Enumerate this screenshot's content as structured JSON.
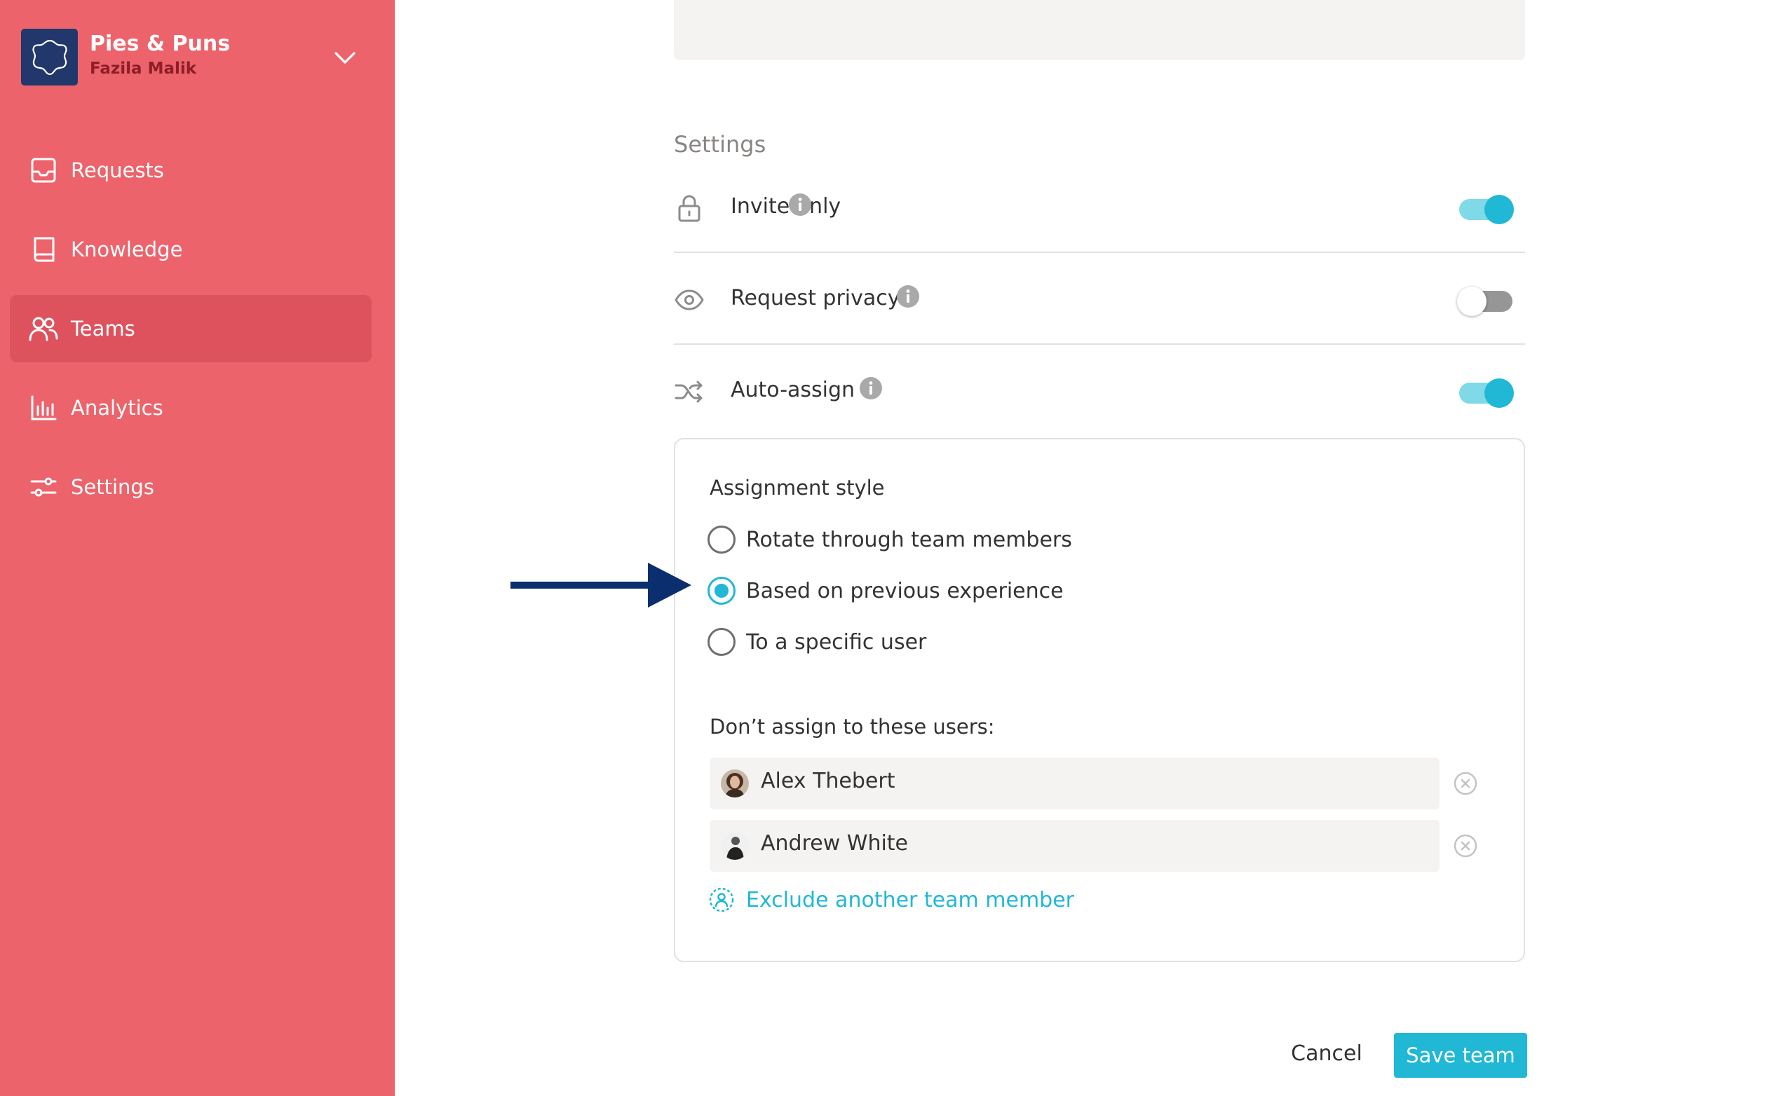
{
  "workspace": {
    "name": "Pies & Puns",
    "user": "Fazila Malik",
    "logo_color": "#22386c",
    "icons": {
      "logo": "flower-badge-icon",
      "switcher": "chevron-down-icon"
    }
  },
  "sidebar": {
    "background": "#ec636c",
    "items": [
      {
        "label": "Requests",
        "icon": "inbox-icon",
        "active": false
      },
      {
        "label": "Knowledge",
        "icon": "book-icon",
        "active": false
      },
      {
        "label": "Teams",
        "icon": "users-icon",
        "active": true
      },
      {
        "label": "Analytics",
        "icon": "bar-chart-icon",
        "active": false
      },
      {
        "label": "Settings",
        "icon": "sliders-icon",
        "active": false
      }
    ]
  },
  "settings": {
    "title": "Settings",
    "rows": [
      {
        "label": "Invite only",
        "icon": "lock-icon",
        "enabled": true
      },
      {
        "label": "Request privacy",
        "icon": "eye-icon",
        "enabled": false
      },
      {
        "label": "Auto-assign",
        "icon": "shuffle-icon",
        "enabled": true
      }
    ]
  },
  "assignment": {
    "title": "Assignment style",
    "options": [
      {
        "label": "Rotate through team members",
        "selected": false
      },
      {
        "label": "Based on previous experience",
        "selected": true
      },
      {
        "label": "To a specific user",
        "selected": false
      }
    ],
    "exclude_title": "Don’t assign to these users:",
    "excluded_users": [
      {
        "name": "Alex Thebert"
      },
      {
        "name": "Andrew White"
      }
    ],
    "add_link": "Exclude another team member"
  },
  "actions": {
    "cancel": "Cancel",
    "save": "Save team"
  },
  "colors": {
    "accent": "#20b8d4",
    "toggle_on_track": "#7fd9e6",
    "annotation_arrow": "#0b2f6e",
    "active_nav": "#de525d"
  }
}
